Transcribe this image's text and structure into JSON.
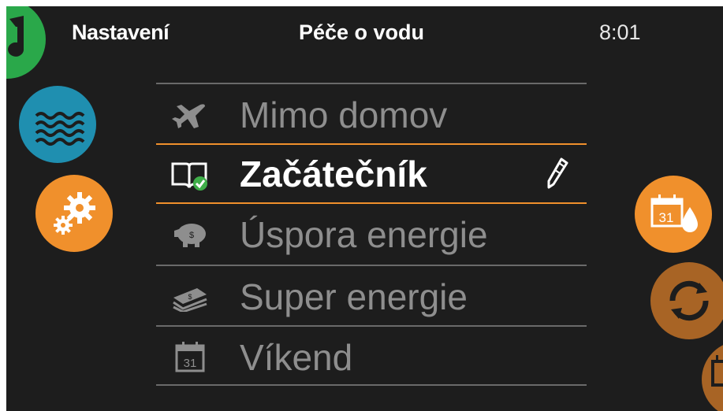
{
  "header": {
    "left_label": "Nastavení",
    "title": "Péče o vodu",
    "time": "8:01"
  },
  "menu": {
    "items": [
      {
        "label": "Mimo domov",
        "icon": "airplane-icon",
        "selected": false
      },
      {
        "label": "Začátečník",
        "icon": "book-check-icon",
        "selected": true,
        "badge_icon": "pencil-icon"
      },
      {
        "label": "Úspora energie",
        "icon": "piggy-bank-icon",
        "selected": false
      },
      {
        "label": "Super energie",
        "icon": "money-stack-icon",
        "selected": false
      },
      {
        "label": "Víkend",
        "icon": "calendar-icon",
        "selected": false,
        "icon_text": "31"
      }
    ]
  },
  "side_buttons": {
    "left": [
      {
        "icon": "music-note-icon",
        "color": "#2aa84a"
      },
      {
        "icon": "water-waves-icon",
        "color": "#1f8fb0"
      },
      {
        "icon": "gears-icon",
        "color": "#f0902c"
      }
    ],
    "right": [
      {
        "icon": "calendar-drop-icon",
        "color": "#f0902c",
        "icon_text": "31"
      },
      {
        "icon": "sync-icon",
        "color": "#a86425"
      },
      {
        "icon": "calendar-icon",
        "color": "#a86425"
      }
    ]
  },
  "colors": {
    "background": "#1d1d1d",
    "accent": "#f0902c",
    "divider": "#6a6a6a",
    "inactive_text": "#8e8e8e",
    "active_text": "#ffffff"
  }
}
